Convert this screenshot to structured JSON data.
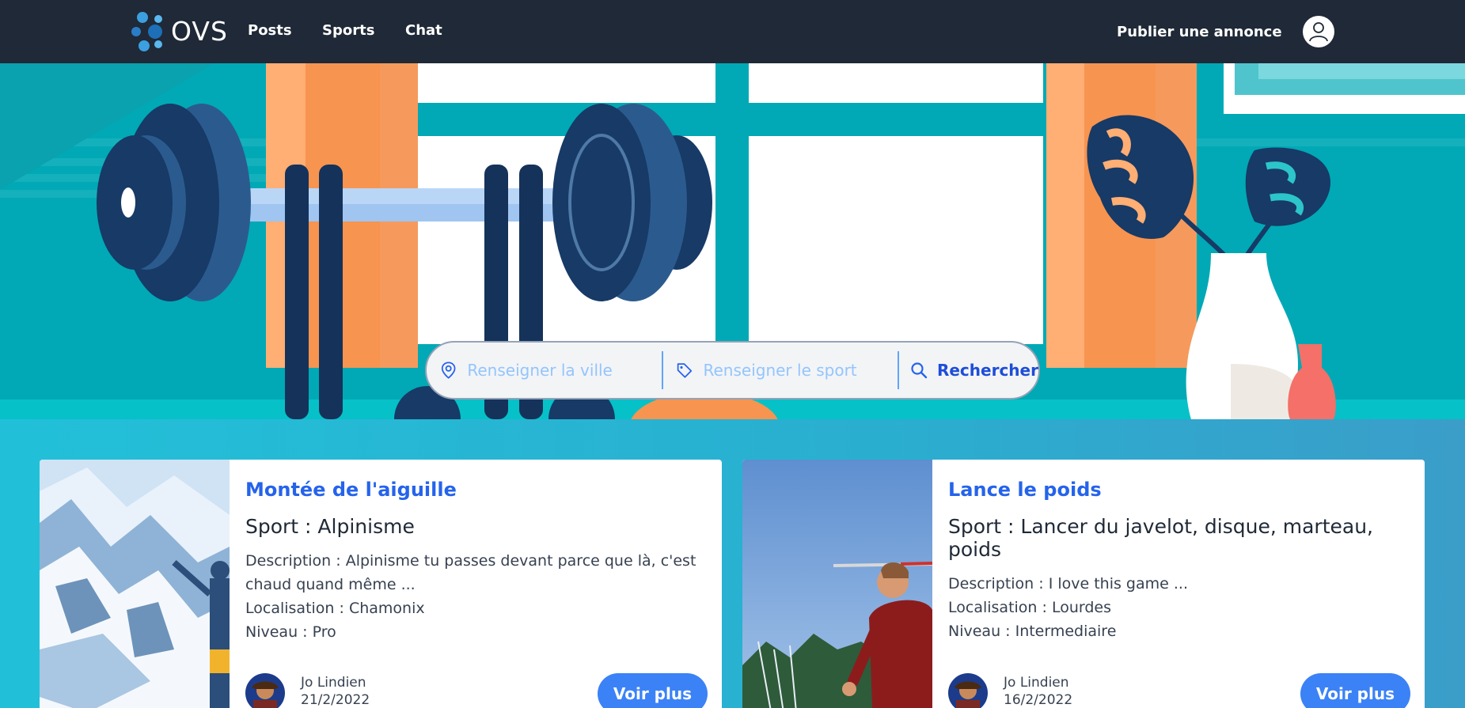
{
  "nav": {
    "logo_text": "OVS",
    "links": [
      "Posts",
      "Sports",
      "Chat"
    ],
    "publish": "Publier une annonce"
  },
  "search": {
    "city_placeholder": "Renseigner la ville",
    "sport_placeholder": "Renseigner le sport",
    "button": "Rechercher"
  },
  "cards": [
    {
      "title": "Montée de l'aiguille",
      "sport": "Sport : Alpinisme",
      "description": "Description : Alpinisme tu passes devant parce que là, c'est chaud quand même ...",
      "location": "Localisation : Chamonix",
      "level": "Niveau : Pro",
      "author": "Jo Lindien",
      "date": "21/2/2022",
      "button": "Voir plus"
    },
    {
      "title": "Lance le poids",
      "sport": "Sport : Lancer du javelot, disque, marteau, poids",
      "description": "Description : I love this game ...",
      "location": "Localisation : Lourdes",
      "level": "Niveau : Intermediaire",
      "author": "Jo Lindien",
      "date": "16/2/2022",
      "button": "Voir plus"
    }
  ],
  "colors": {
    "navbar": "#1f2937",
    "accent": "#3b82f6",
    "title": "#2563eb",
    "hero_teal": "#00a9b5"
  }
}
